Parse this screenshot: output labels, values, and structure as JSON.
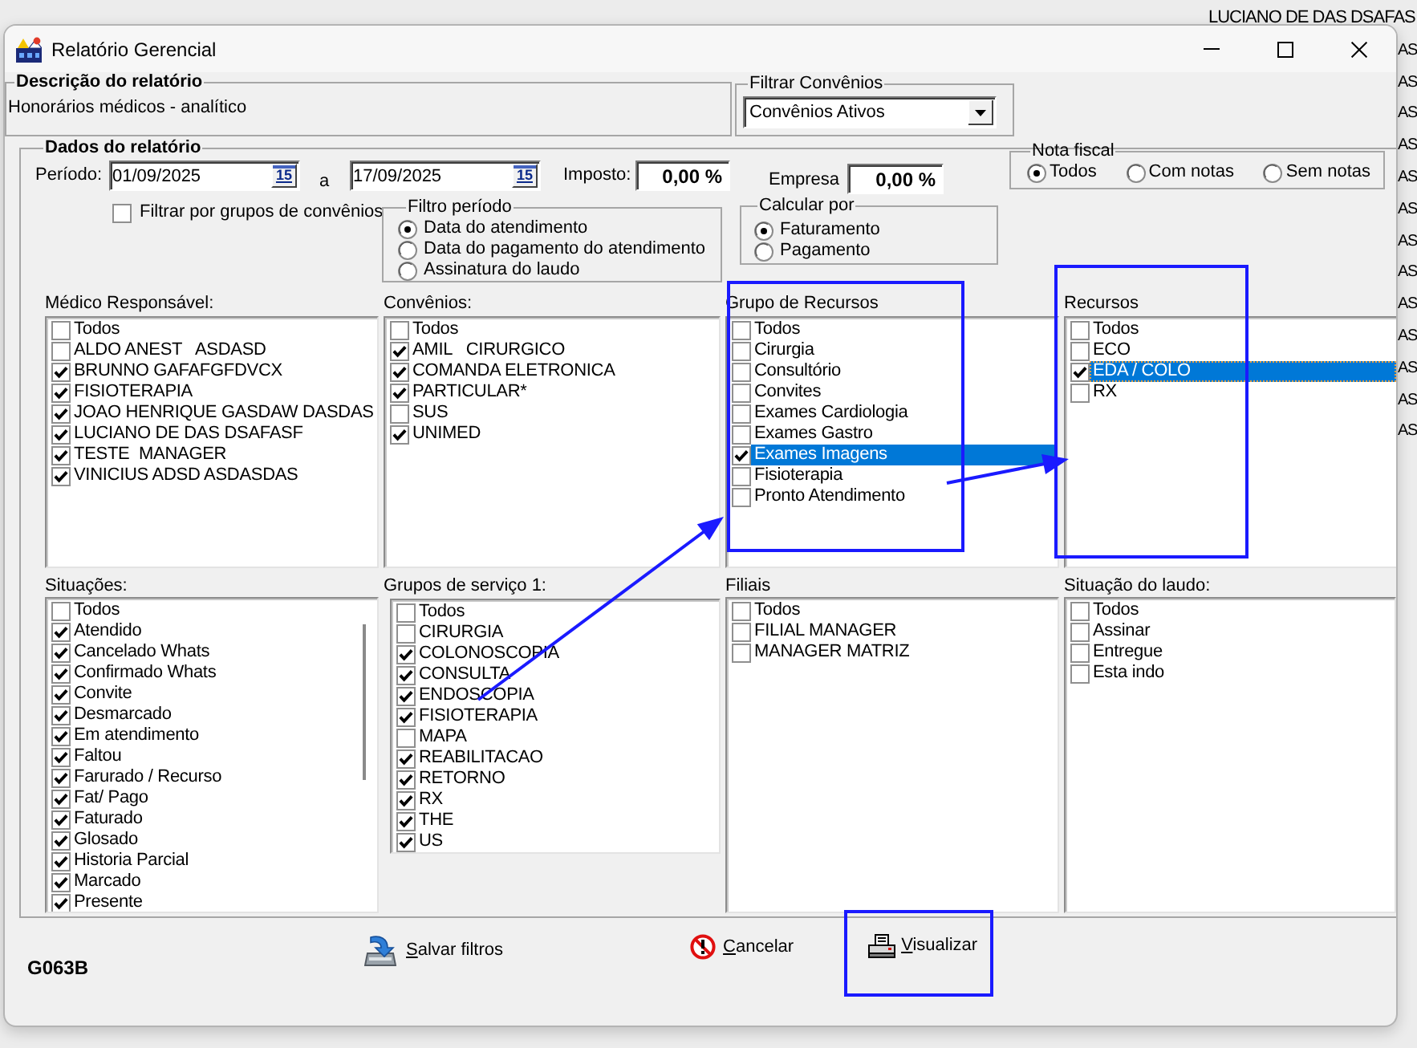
{
  "background_app": {
    "header": "LUCIANO DE DAS DSAFAS",
    "rows": [
      "AS",
      "AS",
      "AS",
      "AS",
      "AS",
      "AS",
      "AS",
      "AS",
      "AS",
      "AS",
      "AS",
      "AS",
      "AS"
    ]
  },
  "window": {
    "title": "Relatório Gerencial"
  },
  "descricao": {
    "title": "Descrição do relatório",
    "text": "Honorários médicos - analítico"
  },
  "filtrar_convenios": {
    "title": "Filtrar Convênios",
    "value": "Convênios Ativos"
  },
  "dados": {
    "title": "Dados do relatório",
    "periodo": {
      "label": "Período:",
      "from": {
        "value": "01/09/2025",
        "calendar": "15"
      },
      "separator": "a",
      "to": {
        "value": "17/09/2025",
        "calendar": "15"
      }
    },
    "imposto": {
      "label": "Imposto:",
      "value": "0,00 %"
    },
    "empresa": {
      "label": "Empresa",
      "value": "0,00 %"
    },
    "nota_fiscal": {
      "title": "Nota fiscal",
      "options": [
        {
          "label": "Todos",
          "selected": true
        },
        {
          "label": "Com notas",
          "selected": false
        },
        {
          "label": "Sem notas",
          "selected": false
        }
      ]
    },
    "filtrar_grupos": {
      "label": "Filtrar por grupos de convênios",
      "checked": false
    },
    "filtro_periodo": {
      "title": "Filtro período",
      "options": [
        {
          "label": "Data do atendimento",
          "selected": true
        },
        {
          "label": "Data do pagamento do atendimento",
          "selected": false
        },
        {
          "label": "Assinatura do laudo",
          "selected": false
        }
      ]
    },
    "calcular_por": {
      "title": "Calcular por",
      "options": [
        {
          "label": "Faturamento",
          "selected": true
        },
        {
          "label": "Pagamento",
          "selected": false
        }
      ]
    },
    "lists": [
      {
        "title": "Médico Responsável:",
        "items": [
          {
            "label": "Todos",
            "checked": false,
            "selected": false
          },
          {
            "label": "ALDO ANEST   ASDASD",
            "checked": false,
            "selected": false
          },
          {
            "label": "BRUNNO GAFAFGFDVCX",
            "checked": true,
            "selected": false
          },
          {
            "label": "FISIOTERAPIA",
            "checked": true,
            "selected": false
          },
          {
            "label": "JOAO HENRIQUE GASDAW DASDAS",
            "checked": true,
            "selected": false
          },
          {
            "label": "LUCIANO DE DAS DSAFASF",
            "checked": true,
            "selected": false
          },
          {
            "label": "TESTE  MANAGER",
            "checked": true,
            "selected": false
          },
          {
            "label": "VINICIUS ADSD ASDASDAS",
            "checked": true,
            "selected": false
          }
        ]
      },
      {
        "title": "Convênios:",
        "items": [
          {
            "label": "Todos",
            "checked": false,
            "selected": false
          },
          {
            "label": "AMIL   CIRURGICO",
            "checked": true,
            "selected": false
          },
          {
            "label": "COMANDA ELETRONICA",
            "checked": true,
            "selected": false
          },
          {
            "label": "PARTICULAR*",
            "checked": true,
            "selected": false
          },
          {
            "label": "SUS",
            "checked": false,
            "selected": false
          },
          {
            "label": "UNIMED",
            "checked": true,
            "selected": false
          }
        ]
      },
      {
        "title": "Grupo de Recursos",
        "items": [
          {
            "label": "Todos",
            "checked": false,
            "selected": false
          },
          {
            "label": "Cirurgia",
            "checked": false,
            "selected": false
          },
          {
            "label": "Consultório",
            "checked": false,
            "selected": false
          },
          {
            "label": "Convites",
            "checked": false,
            "selected": false
          },
          {
            "label": "Exames Cardiologia",
            "checked": false,
            "selected": false
          },
          {
            "label": "Exames Gastro",
            "checked": false,
            "selected": false
          },
          {
            "label": "Exames Imagens",
            "checked": true,
            "selected": true
          },
          {
            "label": "Fisioterapia",
            "checked": false,
            "selected": false
          },
          {
            "label": "Pronto Atendimento",
            "checked": false,
            "selected": false
          }
        ]
      },
      {
        "title": "Recursos",
        "items": [
          {
            "label": "Todos",
            "checked": false,
            "selected": false,
            "focused": false
          },
          {
            "label": "ECO",
            "checked": false,
            "selected": false,
            "focused": false
          },
          {
            "label": "EDA / COLO",
            "checked": true,
            "selected": true,
            "focused": true
          },
          {
            "label": "RX",
            "checked": false,
            "selected": false,
            "focused": false
          }
        ]
      },
      {
        "title": "Situações:",
        "items": [
          {
            "label": "Todos",
            "checked": false,
            "selected": false
          },
          {
            "label": "Atendido",
            "checked": true,
            "selected": false
          },
          {
            "label": "Cancelado Whats",
            "checked": true,
            "selected": false
          },
          {
            "label": "Confirmado Whats",
            "checked": true,
            "selected": false
          },
          {
            "label": "Convite",
            "checked": true,
            "selected": false
          },
          {
            "label": "Desmarcado",
            "checked": true,
            "selected": false
          },
          {
            "label": "Em atendimento",
            "checked": true,
            "selected": false
          },
          {
            "label": "Faltou",
            "checked": true,
            "selected": false
          },
          {
            "label": "Farurado / Recurso",
            "checked": true,
            "selected": false
          },
          {
            "label": "Fat/ Pago",
            "checked": true,
            "selected": false
          },
          {
            "label": "Faturado",
            "checked": true,
            "selected": false
          },
          {
            "label": "Glosado",
            "checked": true,
            "selected": false
          },
          {
            "label": "Historia Parcial",
            "checked": true,
            "selected": false
          },
          {
            "label": "Marcado",
            "checked": true,
            "selected": false
          },
          {
            "label": "Presente",
            "checked": true,
            "selected": false
          }
        ]
      },
      {
        "title": "Grupos de serviço 1:",
        "items": [
          {
            "label": "Todos",
            "checked": false,
            "selected": false
          },
          {
            "label": "CIRURGIA",
            "checked": false,
            "selected": false
          },
          {
            "label": "COLONOSCOPIA",
            "checked": true,
            "selected": false
          },
          {
            "label": "CONSULTA",
            "checked": true,
            "selected": false
          },
          {
            "label": "ENDOSCOPIA",
            "checked": true,
            "selected": false
          },
          {
            "label": "FISIOTERAPIA",
            "checked": true,
            "selected": false
          },
          {
            "label": "MAPA",
            "checked": false,
            "selected": false
          },
          {
            "label": "REABILITACAO",
            "checked": true,
            "selected": false
          },
          {
            "label": "RETORNO",
            "checked": true,
            "selected": false
          },
          {
            "label": "RX",
            "checked": true,
            "selected": false
          },
          {
            "label": "THE",
            "checked": true,
            "selected": false
          },
          {
            "label": "US",
            "checked": true,
            "selected": false
          }
        ]
      },
      {
        "title": "Filiais",
        "items": [
          {
            "label": "Todos",
            "checked": false,
            "selected": false
          },
          {
            "label": "FILIAL MANAGER",
            "checked": false,
            "selected": false
          },
          {
            "label": "MANAGER MATRIZ",
            "checked": false,
            "selected": false
          }
        ]
      },
      {
        "title": "Situação do laudo:",
        "items": [
          {
            "label": "Todos",
            "checked": false,
            "selected": false
          },
          {
            "label": "Assinar",
            "checked": false,
            "selected": false
          },
          {
            "label": "Entregue",
            "checked": false,
            "selected": false
          },
          {
            "label": "Esta indo",
            "checked": false,
            "selected": false
          }
        ]
      }
    ]
  },
  "form_code": "G063B",
  "buttons": [
    {
      "kind": "save",
      "label": "Salvar filtros"
    },
    {
      "kind": "cancel",
      "label": "Cancelar"
    },
    {
      "kind": "view",
      "label": "Visualizar"
    }
  ]
}
